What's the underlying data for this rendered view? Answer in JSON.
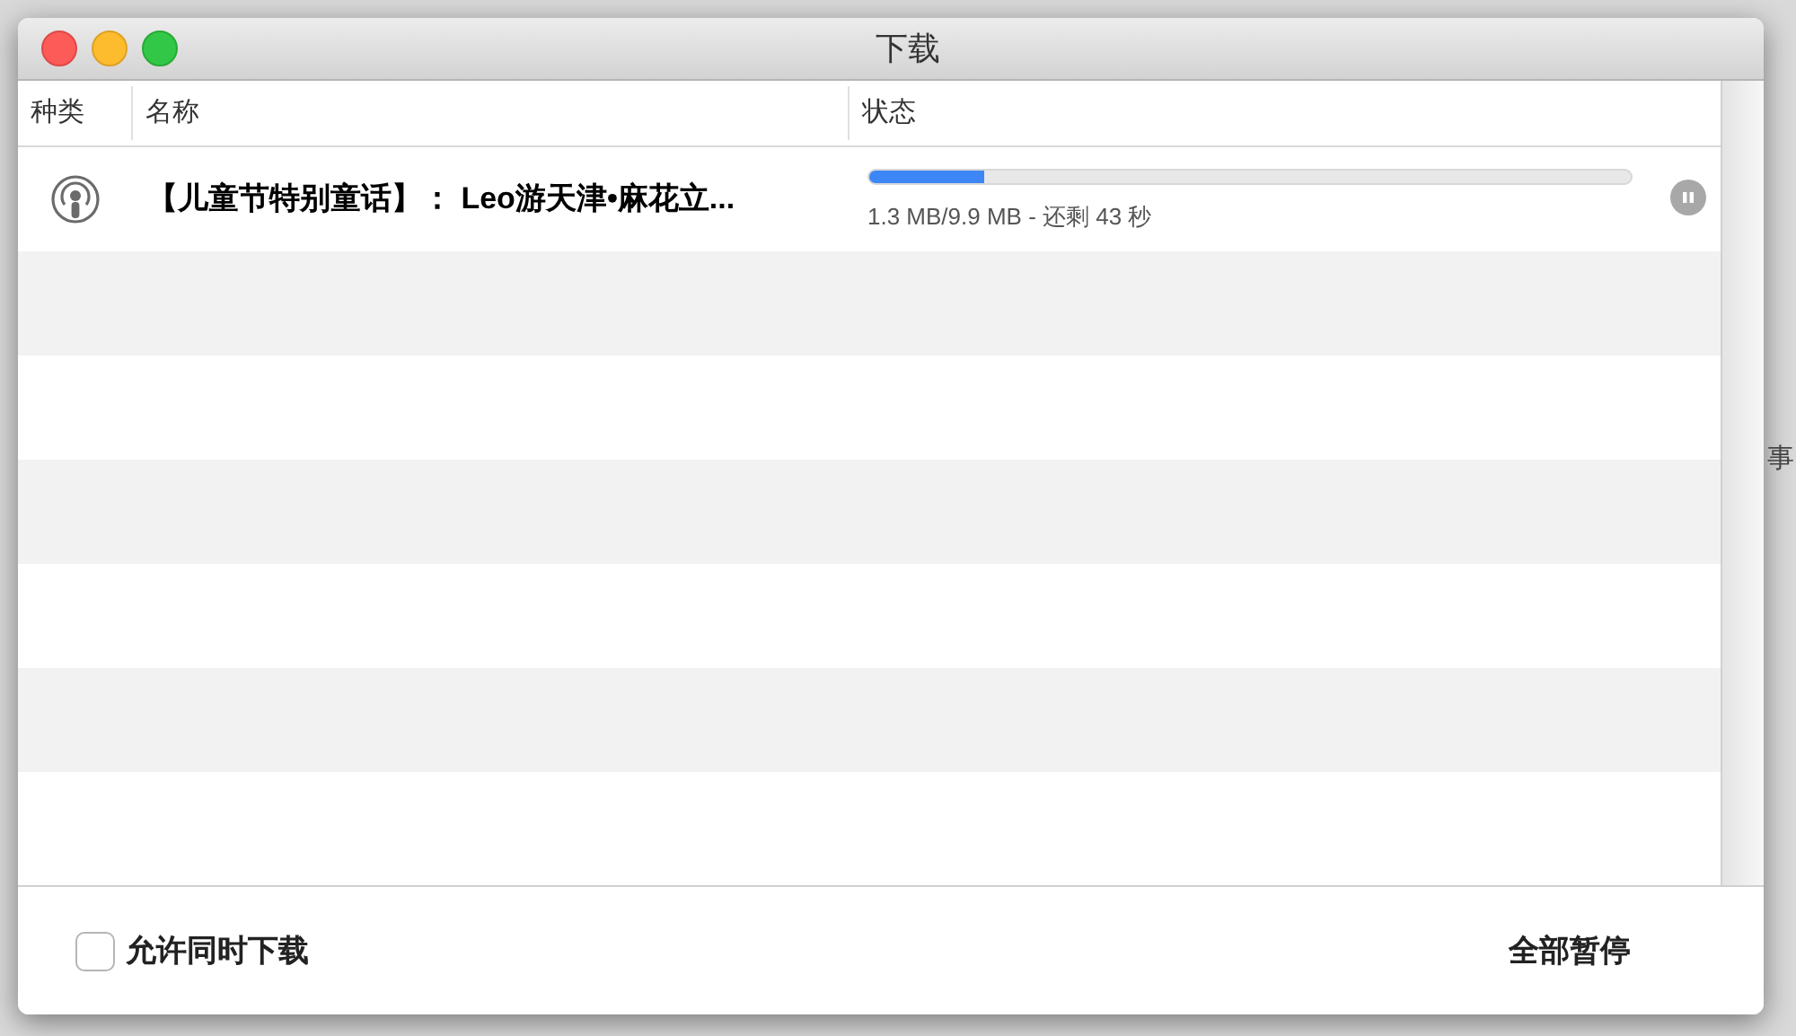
{
  "background": {
    "side_text": "事"
  },
  "window": {
    "title": "下载"
  },
  "table": {
    "columns": [
      "种类",
      "名称",
      "状态"
    ],
    "rows": [
      {
        "kind": "podcast",
        "name": "【儿童节特别童话】： Leo游天津•麻花立...",
        "level": 0.15,
        "status": "1.3 MB/9.9 MB - 还剩 43 秒",
        "paused": false
      }
    ]
  },
  "footer": {
    "checkbox": {
      "label": "允许同时下载",
      "checked": false
    },
    "button": "全部暂停"
  }
}
